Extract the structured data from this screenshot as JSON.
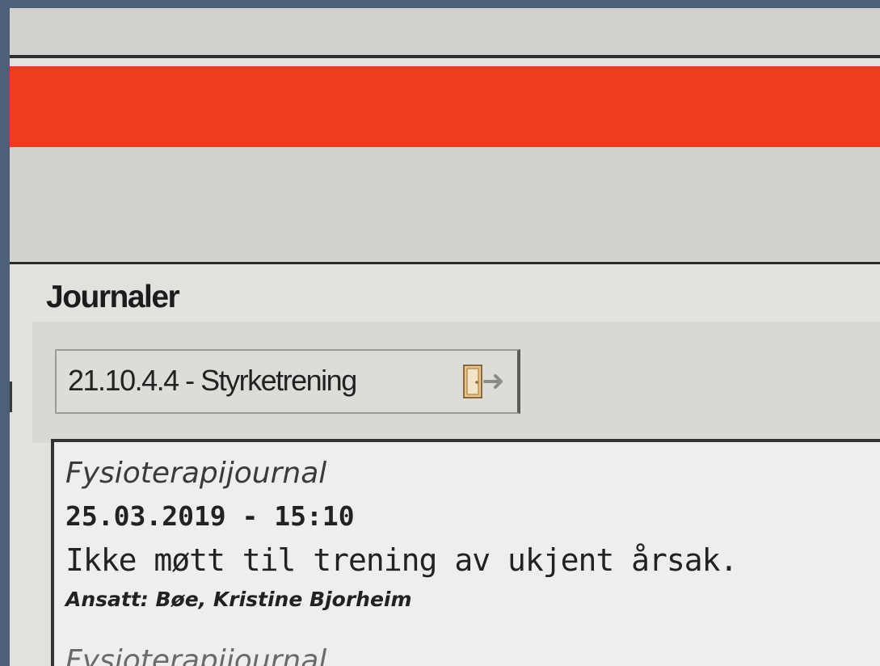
{
  "journals": {
    "heading": "Journaler",
    "selected_journal": "21.10.4.4 - Styrketrening",
    "open_icon": "door-exit-icon",
    "entries": [
      {
        "type": "Fysioterapijournal",
        "datetime": "25.03.2019 - 15:10",
        "text": "Ikke møtt til trening av ukjent årsak.",
        "staff": "Ansatt: Bøe, Kristine Bjorheim"
      },
      {
        "type": "Fysioterapijournal"
      }
    ]
  },
  "colors": {
    "header_bar": "#ef3b1e",
    "background": "#d6d5d1"
  }
}
